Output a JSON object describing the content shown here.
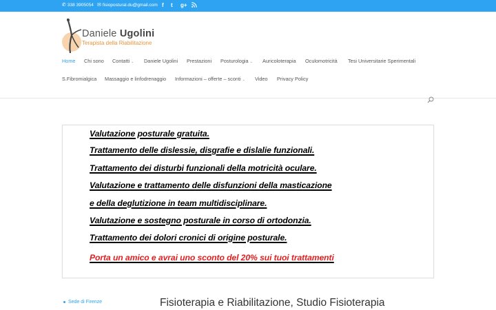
{
  "topbar": {
    "phone": "338 3905054",
    "email": "fisiopostural.du@gmail.com",
    "social": [
      "f",
      "t",
      "g+",
      "rss"
    ]
  },
  "logo": {
    "first_name": "Daniele",
    "last_name": "Ugolini",
    "subtitle": "Terapista della Riabilitazione"
  },
  "nav": {
    "row1": [
      {
        "label": "Home",
        "active": true
      },
      {
        "label": "Chi sono"
      },
      {
        "label": "Contatti",
        "dropdown": true
      },
      {
        "label": "Daniele Ugolini"
      },
      {
        "label": "Prestazioni"
      },
      {
        "label": "Posturologia",
        "dropdown": true
      },
      {
        "label": "Auricoloterapia"
      },
      {
        "label": "Oculomotricità"
      },
      {
        "label": "Tesi Universitarie Sperimentali"
      }
    ],
    "row2": [
      {
        "label": "S.Fibromialgica"
      },
      {
        "label": "Massaggio e linfodrenaggio"
      },
      {
        "label": "Informazioni – offerte – sconti",
        "dropdown": true
      },
      {
        "label": "Video"
      },
      {
        "label": "Privacy Policy"
      }
    ]
  },
  "banner": {
    "lines": [
      "Valutazione posturale gratuita.",
      "Trattamento delle dislessie, disgrafie e dislalie funzionali.",
      "Trattamento dei disturbi funzionali della motricità oculare.",
      "Valutazione e trattamento delle disfunzioni della masticazione",
      "e della deglutizione in team multidisciplinare.",
      "Valutazione e sostegno posturale in corso di ortodonzia.",
      "Trattamento dei dolori cronici di origine posturale."
    ],
    "promo": "Porta un amico e avrai uno sconto del 20% sui tuoi trattamenti"
  },
  "sidebar": {
    "link": "Sede di Firenze"
  },
  "main": {
    "title": "Fisioterapia e Riabilitazione, Studio Fisioterapia"
  },
  "colors": {
    "accent": "#2ea3f2",
    "logo_orange": "#e8943a",
    "promo_red": "#e02020"
  }
}
